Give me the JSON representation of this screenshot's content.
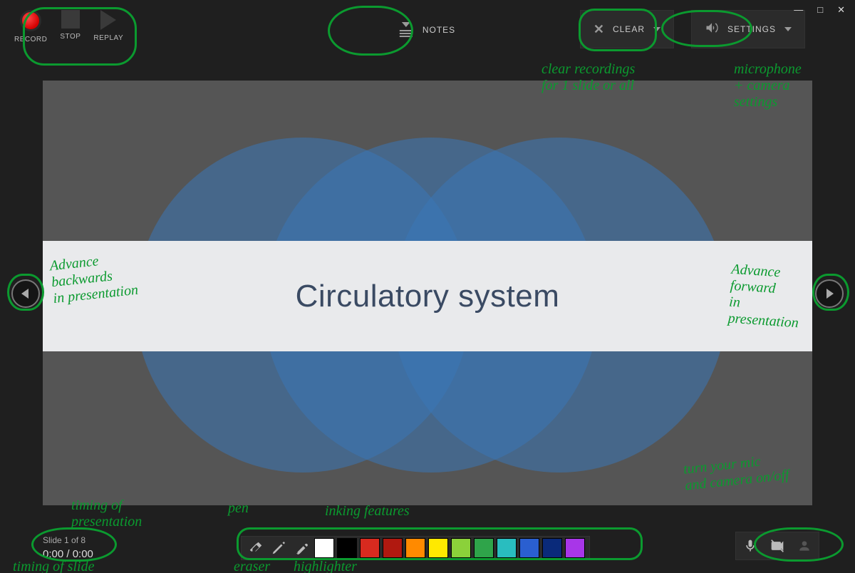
{
  "window": {
    "minimize": "—",
    "maximize": "□",
    "close": "✕"
  },
  "toolbar": {
    "record_label": "RECORD",
    "stop_label": "STOP",
    "replay_label": "REPLAY",
    "notes_label": "NOTES",
    "clear_label": "CLEAR",
    "settings_label": "SETTINGS"
  },
  "slide": {
    "title": "Circulatory system"
  },
  "status": {
    "slide_indicator": "Slide 1 of 8",
    "time": "0:00 / 0:00"
  },
  "ink": {
    "tools": {
      "eraser": "eraser",
      "pen": "pen",
      "highlighter": "highlighter"
    },
    "swatches": [
      "#ffffff",
      "#000000",
      "#d82a1f",
      "#b01910",
      "#ff8a00",
      "#ffe900",
      "#8bd13a",
      "#2fa44a",
      "#29bdbf",
      "#2a5fd0",
      "#0a2a7a",
      "#a836e8"
    ]
  },
  "media": {
    "mic": "microphone",
    "cam": "camera",
    "cameo": "cameo"
  },
  "annotations": {
    "rec_group": "",
    "notes": "",
    "clear": "clear recordings\nfor 1 slide or all",
    "settings": "microphone\n+ camera\nsettings",
    "prev": "Advance\nbackwards\nin presentation",
    "next": "Advance\nforward\nin\npresentation",
    "timing_pres": "timing of\npresentation",
    "timing_slide": "timing of slide",
    "pen": "pen",
    "inking": "inking features",
    "eraser": "eraser",
    "highlighter": "highlighter",
    "media": "turn your mic\nand camera on/off"
  }
}
